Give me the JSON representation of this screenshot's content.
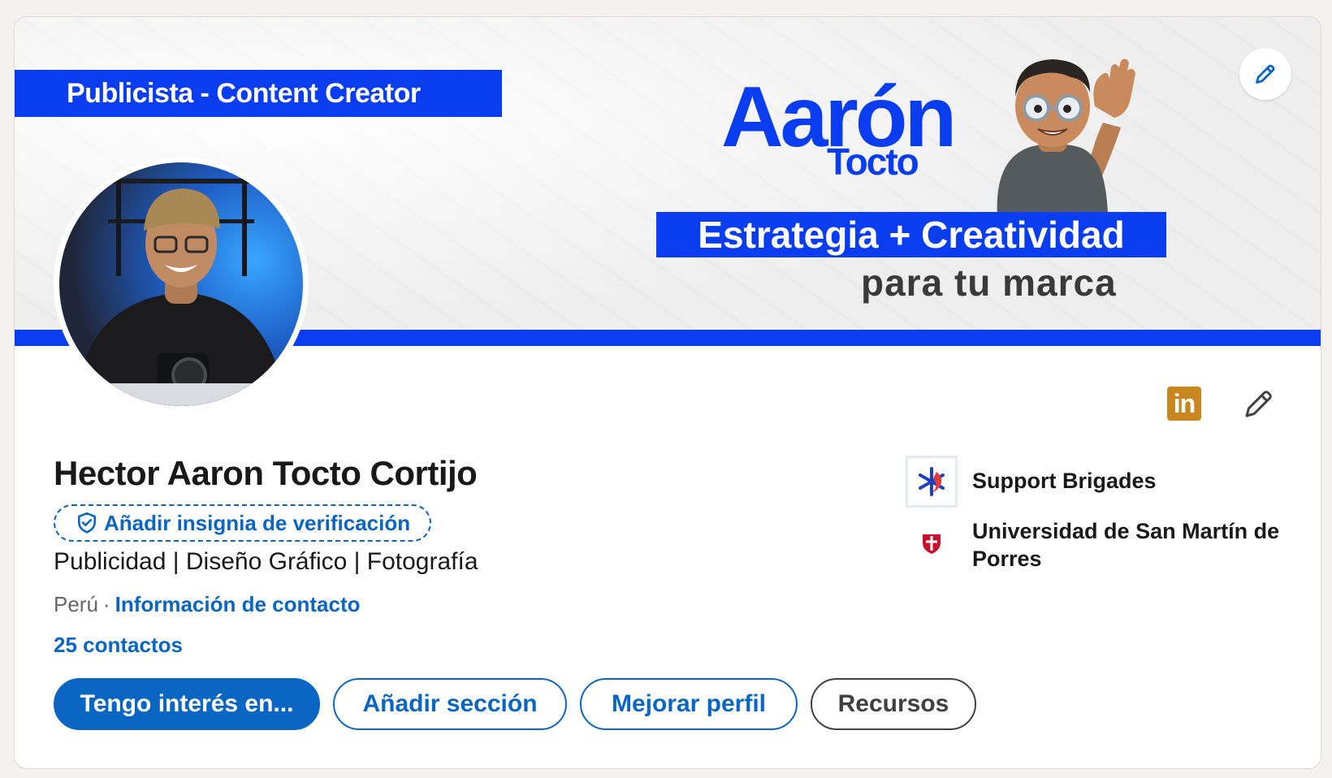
{
  "banner": {
    "tag": "Publicista - Content Creator",
    "name": "Aarón",
    "surname": "Tocto",
    "slogan_line1": "Estrategia + Creatividad",
    "slogan_line2": "para  tu marca"
  },
  "profile": {
    "name": "Hector Aaron Tocto Cortijo",
    "verify_label": "Añadir insignia de verificación",
    "headline": "Publicidad | Diseño Gráfico | Fotografía",
    "location": "Perú",
    "separator": "·",
    "contact_link": "Información de contacto",
    "connections": "25 contactos"
  },
  "actions": {
    "open_to": "Tengo interés en...",
    "add_section": "Añadir sección",
    "enhance": "Mejorar perfil",
    "resources": "Recursos"
  },
  "experience": [
    {
      "label": "Support Brigades"
    },
    {
      "label": "Universidad de San Martín de Porres"
    }
  ],
  "icons": {
    "linkedin_badge": "in",
    "edit": "pencil-icon",
    "verify": "shield-check-icon"
  },
  "colors": {
    "brand_blue": "#0a66c2",
    "banner_blue": "#0a3cf0",
    "linkedin_gold": "#c8881f"
  }
}
